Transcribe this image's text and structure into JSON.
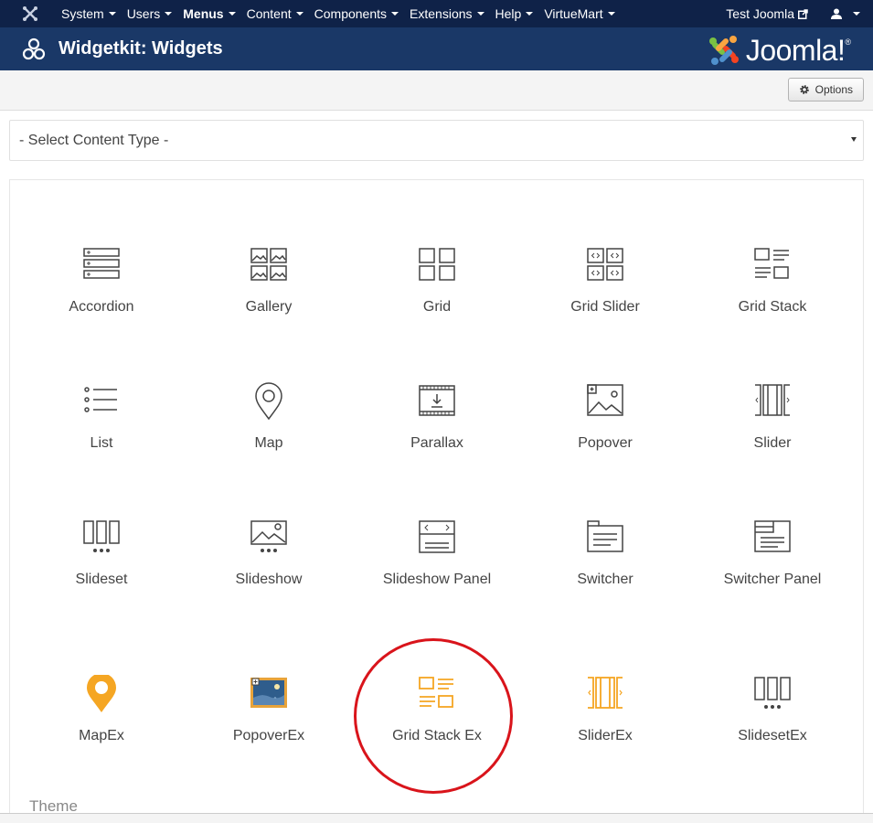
{
  "topbar": {
    "menu": [
      {
        "label": "System",
        "active": false
      },
      {
        "label": "Users",
        "active": false
      },
      {
        "label": "Menus",
        "active": true
      },
      {
        "label": "Content",
        "active": false
      },
      {
        "label": "Components",
        "active": false
      },
      {
        "label": "Extensions",
        "active": false
      },
      {
        "label": "Help",
        "active": false
      },
      {
        "label": "VirtueMart",
        "active": false
      }
    ],
    "site_link": "Test Joomla",
    "user_icon": "user-icon"
  },
  "header": {
    "title": "Widgetkit: Widgets",
    "brand": "Joomla!",
    "brand_reg": "®"
  },
  "toolbar": {
    "options_label": "Options"
  },
  "content_type": {
    "selected": "- Select Content Type -"
  },
  "widgets": [
    {
      "label": "Accordion",
      "icon": "accordion-icon"
    },
    {
      "label": "Gallery",
      "icon": "gallery-icon"
    },
    {
      "label": "Grid",
      "icon": "grid-icon"
    },
    {
      "label": "Grid Slider",
      "icon": "grid-slider-icon"
    },
    {
      "label": "Grid Stack",
      "icon": "grid-stack-icon"
    },
    {
      "label": "List",
      "icon": "list-icon"
    },
    {
      "label": "Map",
      "icon": "map-icon"
    },
    {
      "label": "Parallax",
      "icon": "parallax-icon"
    },
    {
      "label": "Popover",
      "icon": "popover-icon"
    },
    {
      "label": "Slider",
      "icon": "slider-icon"
    },
    {
      "label": "Slideset",
      "icon": "slideset-icon"
    },
    {
      "label": "Slideshow",
      "icon": "slideshow-icon"
    },
    {
      "label": "Slideshow Panel",
      "icon": "slideshow-panel-icon"
    },
    {
      "label": "Switcher",
      "icon": "switcher-icon"
    },
    {
      "label": "Switcher Panel",
      "icon": "switcher-panel-icon"
    },
    {
      "label": "MapEx",
      "icon": "map-marker-icon"
    },
    {
      "label": "PopoverEx",
      "icon": "popover-image-icon"
    },
    {
      "label": "Grid Stack Ex",
      "icon": "grid-stack-ex-icon"
    },
    {
      "label": "SliderEx",
      "icon": "slider-ex-icon"
    },
    {
      "label": "SlidesetEx",
      "icon": "slideset-ex-icon"
    }
  ],
  "theme_label": "Theme",
  "colors": {
    "navbar": "#0f2248",
    "header": "#1a3867",
    "accent": "#f5a623",
    "highlight_circle": "#d9141b"
  }
}
